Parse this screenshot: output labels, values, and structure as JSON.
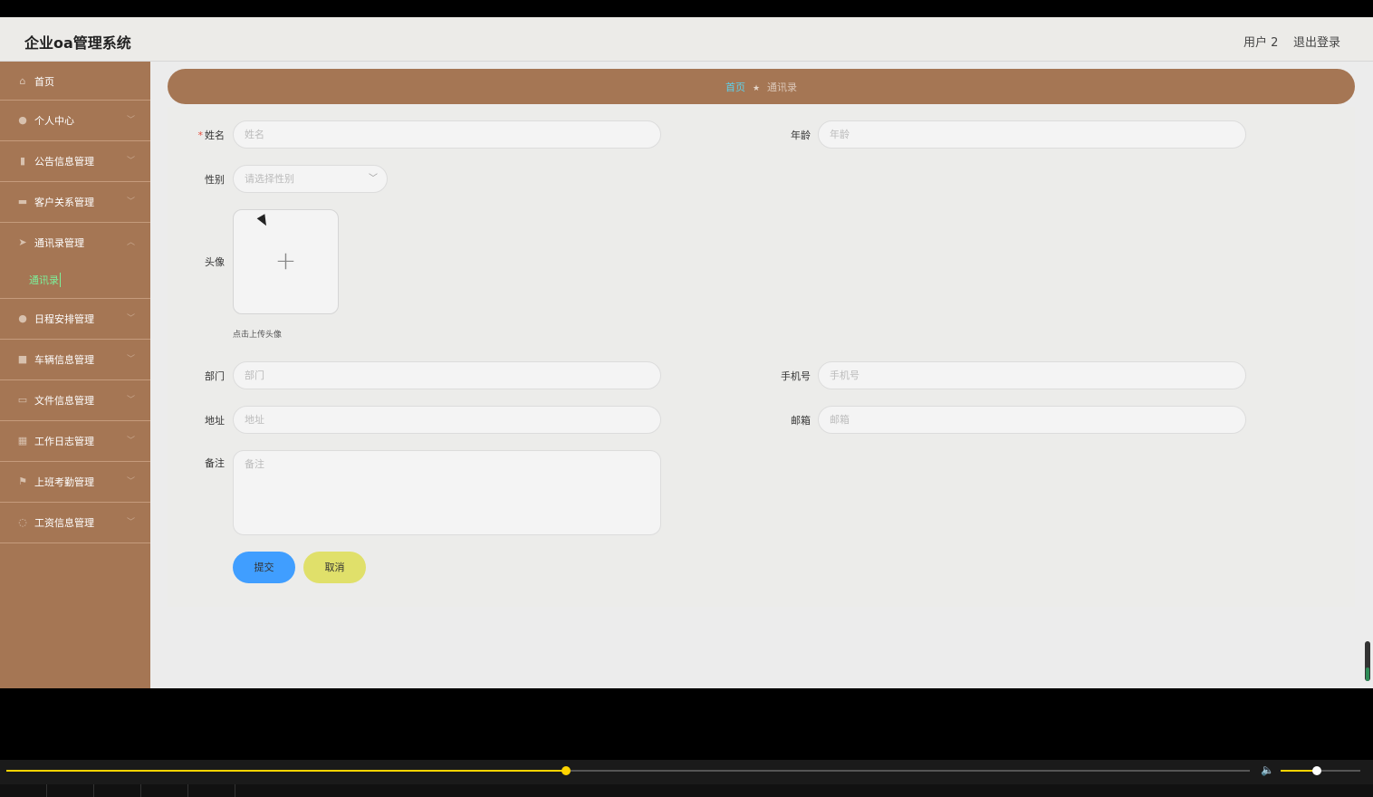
{
  "header": {
    "title": "企业oa管理系统",
    "user": "用户 2",
    "logout": "退出登录"
  },
  "sidebar": {
    "items": [
      {
        "label": "首页",
        "icon": "home-icon",
        "glyph": "⌂"
      },
      {
        "label": "个人中心",
        "icon": "user-icon",
        "glyph": "●"
      },
      {
        "label": "公告信息管理",
        "icon": "bar-chart-icon",
        "glyph": "▮"
      },
      {
        "label": "客户关系管理",
        "icon": "document-icon",
        "glyph": "▬"
      },
      {
        "label": "通讯录管理",
        "icon": "send-icon",
        "glyph": "➤",
        "expanded": true
      },
      {
        "label": "日程安排管理",
        "icon": "person-icon",
        "glyph": "●"
      },
      {
        "label": "车辆信息管理",
        "icon": "briefcase-icon",
        "glyph": "■"
      },
      {
        "label": "文件信息管理",
        "icon": "file-icon",
        "glyph": "▭"
      },
      {
        "label": "工作日志管理",
        "icon": "grid-icon",
        "glyph": "▦"
      },
      {
        "label": "上班考勤管理",
        "icon": "flag-icon",
        "glyph": "⚑"
      },
      {
        "label": "工资信息管理",
        "icon": "power-icon",
        "glyph": "◌"
      }
    ],
    "sub_item": "通讯录"
  },
  "breadcrumb": {
    "home": "首页",
    "separator": "★",
    "current": "通讯录"
  },
  "form": {
    "name_label": "姓名",
    "name_placeholder": "姓名",
    "age_label": "年龄",
    "age_placeholder": "年龄",
    "gender_label": "性别",
    "gender_placeholder": "请选择性别",
    "avatar_label": "头像",
    "avatar_tip": "点击上传头像",
    "dept_label": "部门",
    "dept_placeholder": "部门",
    "phone_label": "手机号",
    "phone_placeholder": "手机号",
    "address_label": "地址",
    "address_placeholder": "地址",
    "email_label": "邮箱",
    "email_placeholder": "邮箱",
    "note_label": "备注",
    "note_placeholder": "备注",
    "submit": "提交",
    "cancel": "取消"
  },
  "player": {
    "progress": 0.45,
    "volume": 0.45
  },
  "colors": {
    "sidebar": "#a57654",
    "submit": "#409eff",
    "cancel": "#e0e06a",
    "active": "#7cf09a",
    "progress": "#ffd400"
  }
}
